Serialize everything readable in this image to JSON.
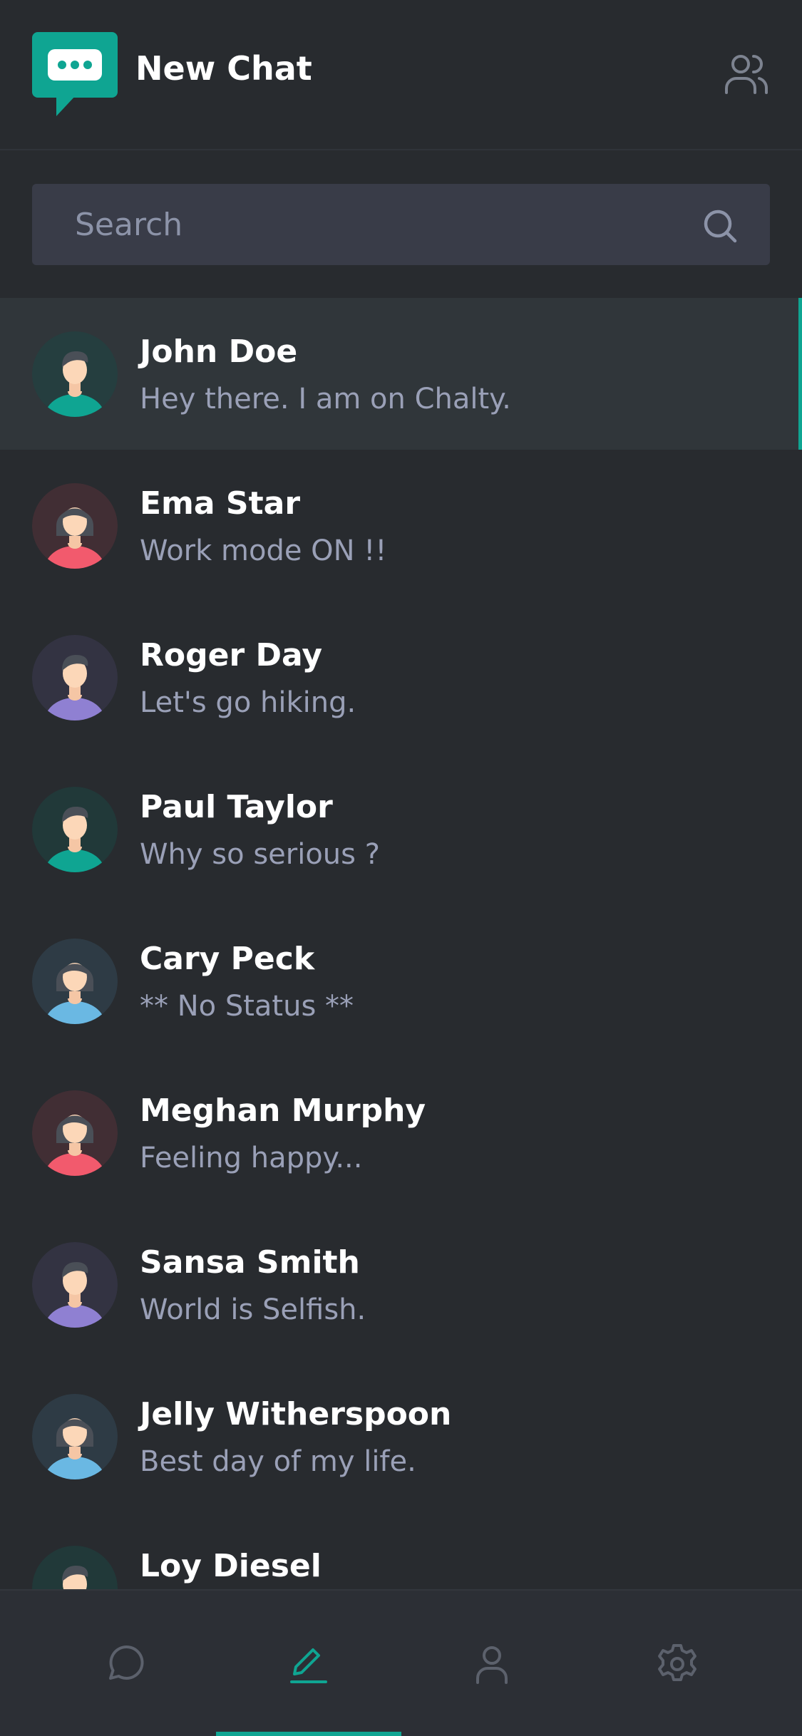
{
  "app": {
    "title": "New Chat",
    "accent_color": "#0fa592",
    "logo_icon": "chat-bubble-dots-icon"
  },
  "header": {
    "contacts_icon": "users-icon"
  },
  "search": {
    "placeholder": "Search",
    "value": "",
    "icon": "search-icon"
  },
  "contacts": [
    {
      "name": "John Doe",
      "status": "Hey there. I am on Chalty.",
      "avatar": "male-avatar",
      "color": "#0fa592",
      "active": true
    },
    {
      "name": "Ema Star",
      "status": "Work mode ON !!",
      "avatar": "female-avatar",
      "color": "#f25a6d",
      "active": false
    },
    {
      "name": "Roger Day",
      "status": "Let's go hiking.",
      "avatar": "male-avatar",
      "color": "#8f80d2",
      "active": false
    },
    {
      "name": "Paul Taylor",
      "status": "Why so serious ?",
      "avatar": "male-avatar",
      "color": "#0fa592",
      "active": false
    },
    {
      "name": "Cary Peck",
      "status": "** No Status **",
      "avatar": "female-avatar",
      "color": "#6ab8e3",
      "active": false
    },
    {
      "name": "Meghan Murphy",
      "status": "Feeling happy...",
      "avatar": "female-avatar",
      "color": "#f25a6d",
      "active": false
    },
    {
      "name": "Sansa Smith",
      "status": "World is Selfish.",
      "avatar": "male-avatar",
      "color": "#8f80d2",
      "active": false
    },
    {
      "name": "Jelly Witherspoon",
      "status": "Best day of my life.",
      "avatar": "female-avatar",
      "color": "#6ab8e3",
      "active": false
    },
    {
      "name": "Loy Diesel",
      "status": "",
      "avatar": "male-avatar",
      "color": "#0fa592",
      "active": false
    }
  ],
  "bottom_nav": {
    "items": [
      {
        "icon": "chat-bubble-icon",
        "active": false
      },
      {
        "icon": "edit-pen-icon",
        "active": true
      },
      {
        "icon": "user-icon",
        "active": false
      },
      {
        "icon": "settings-gear-icon",
        "active": false
      }
    ]
  }
}
